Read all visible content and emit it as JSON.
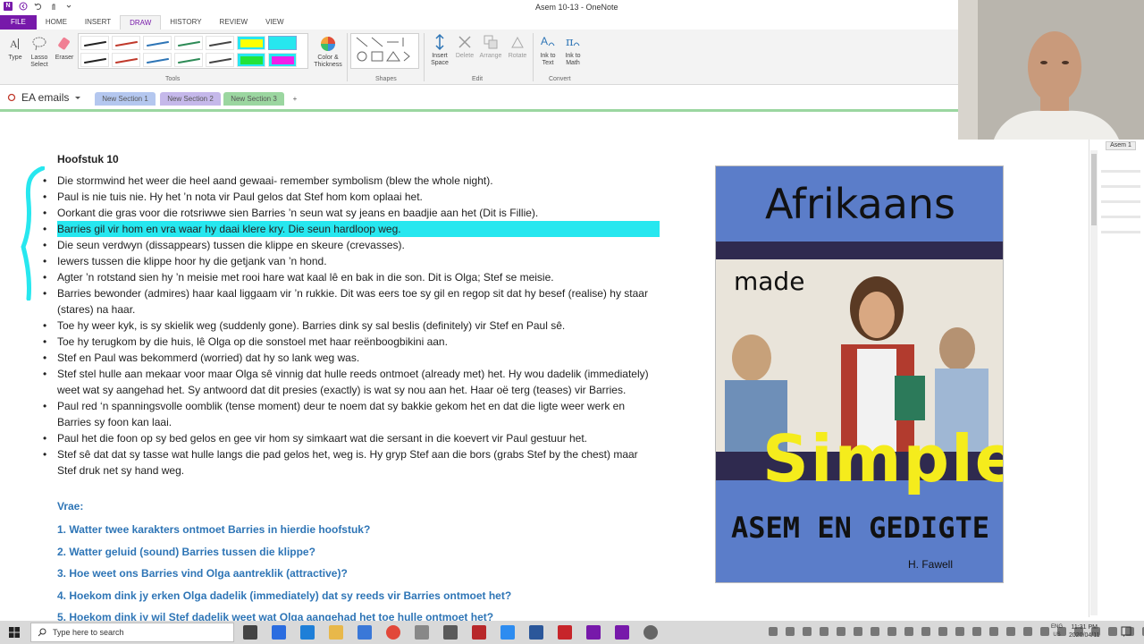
{
  "window": {
    "title": "Asem 10-13 - OneNote"
  },
  "ribbon": {
    "tabs": [
      "FILE",
      "HOME",
      "INSERT",
      "DRAW",
      "HISTORY",
      "REVIEW",
      "VIEW"
    ],
    "active_tab": "DRAW",
    "tools": {
      "type": "Type",
      "lasso": "Lasso Select",
      "eraser": "Eraser",
      "color": "Color & Thickness",
      "group": "Tools"
    },
    "shapes_group": "Shapes",
    "edit": {
      "insert_space": "Insert Space",
      "delete": "Delete",
      "arrange": "Arrange",
      "rotate": "Rotate",
      "group": "Edit"
    },
    "convert": {
      "ink_to_text": "Ink to Text",
      "ink_to_math": "Ink to Math",
      "group": "Convert"
    }
  },
  "notebook": {
    "name": "EA emails",
    "sections": [
      "New Section 1",
      "New Section 2",
      "New Section 3"
    ],
    "active_section": "New Section 3",
    "add_label": "+"
  },
  "page_tab": "Asem 1",
  "content": {
    "chapter_title": "Hoofstuk 10",
    "bullets": [
      "Die stormwind het weer die heel aand gewaai- remember symbolism (blew the whole night).",
      "Paul is nie tuis nie. Hy het ’n nota vir Paul gelos dat Stef hom kom oplaai het.",
      "Oorkant die gras voor die rotsriwwe sien Barries ’n seun wat sy jeans en baadjie aan het (Dit is Fillie).",
      "Barries gil vir hom en vra waar hy daai klere kry. Die seun hardloop weg.",
      "Die seun verdwyn (dissappears) tussen die klippe en skeure (crevasses).",
      "Iewers tussen die klippe hoor hy die getjank van ’n hond.",
      "Agter ’n rotstand sien hy ’n meisie met rooi hare wat kaal lê en bak in die son. Dit is Olga; Stef se meisie.",
      "Barries bewonder (admires) haar kaal liggaam vir ’n rukkie. Dit was eers toe sy gil en regop sit dat hy besef (realise) hy staar (stares) na haar.",
      "Toe hy weer kyk, is sy skielik weg (suddenly gone). Barries dink sy sal beslis (definitely) vir Stef en Paul sê.",
      "Toe hy terugkom by die huis, lê Olga op die sonstoel met haar reënboogbikini aan.",
      "Stef en Paul was bekommerd (worried) dat hy so lank weg was.",
      "Stef stel hulle aan mekaar voor maar Olga sê vinnig dat hulle reeds ontmoet (already met) het. Hy wou dadelik (immediately) weet wat sy aangehad het. Sy antwoord dat dit presies (exactly) is wat sy nou aan het. Haar oë terg (teases) vir Barries.",
      "Paul red ‘n spanningsvolle oomblik (tense moment) deur te noem dat sy bakkie gekom het en dat die ligte weer werk en Barries sy foon kan laai.",
      "Paul het die foon op sy bed gelos en gee vir hom sy simkaart wat die sersant in die koevert vir Paul gestuur het.",
      "Stef sê dat dat sy tasse wat hulle langs die pad gelos het, weg is. Hy gryp Stef aan die bors (grabs Stef by the chest) maar Stef druk net sy hand weg."
    ],
    "vrae_label": "Vrae:",
    "questions": [
      "1. Watter twee karakters ontmoet Barries in hierdie hoofstuk?",
      "2. Watter geluid (sound) Barries tussen die klippe?",
      "3. Hoe weet ons Barries vind Olga aantreklik (attractive)?",
      "4. Hoekom dink jy erken Olga dadelik (immediately) dat sy reeds vir Barries ontmoet het?",
      "5. Hoekom dink jy wil Stef dadelik weet wat Olga aangehad het toe hulle ontmoet het?"
    ]
  },
  "book": {
    "title": "Afrikaans",
    "made": "made",
    "simple": "Simple",
    "subtitle": "ASEM EN GEDIGTE",
    "author": "H. Fawell"
  },
  "taskbar": {
    "search_placeholder": "Type here to search",
    "lang_line1": "ENG",
    "lang_line2": "US",
    "time": "11:31 PM",
    "date": "2020/04/11"
  },
  "colors": {
    "onenote_purple": "#7719aa",
    "highlight_cyan": "#27e7ef",
    "question_blue": "#2e75b6",
    "section_active": "#9bd6a0"
  }
}
